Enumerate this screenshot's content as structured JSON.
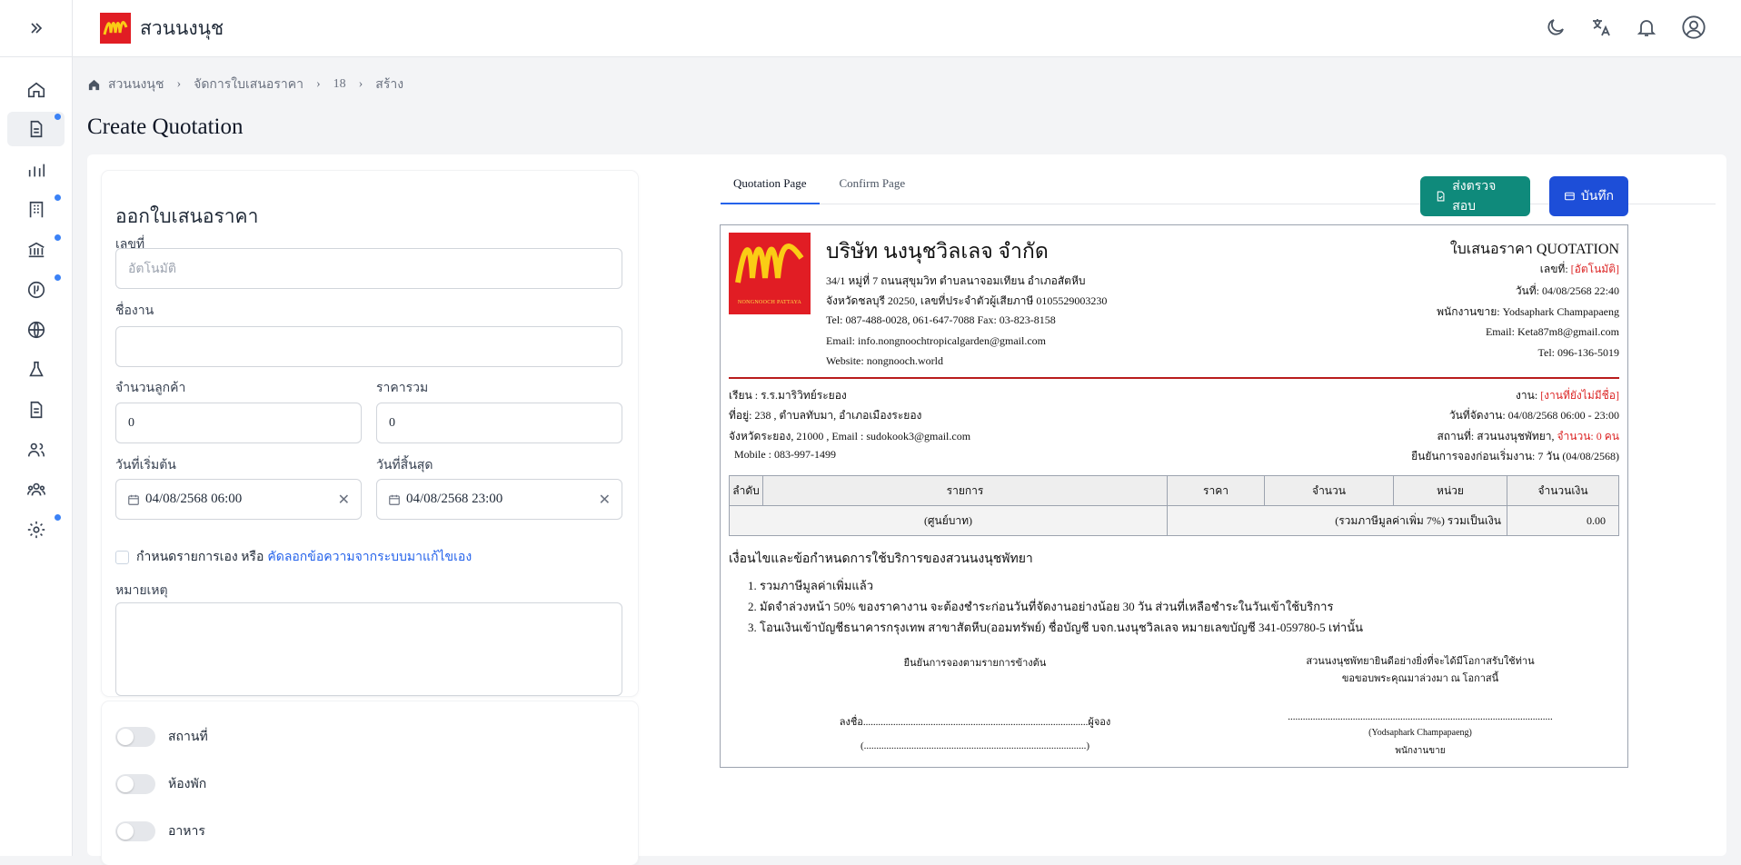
{
  "header": {
    "brand": "สวนนงนุช"
  },
  "breadcrumb": {
    "home": "สวนนงนุช",
    "section": "จัดการใบเสนอราคา",
    "id": "18",
    "action": "สร้าง"
  },
  "page": {
    "title": "Create Quotation"
  },
  "form": {
    "title": "ออกใบเสนอราคา",
    "number_label": "เลขที่",
    "number_placeholder": "อัตโนมัติ",
    "job_label": "ชื่องาน",
    "job_value": "",
    "customers_label": "จำนวนลูกค้า",
    "customers_value": "0",
    "total_label": "ราคารวม",
    "total_value": "0",
    "start_label": "วันที่เริ่มต้น",
    "start_value": "04/08/2568 06:00",
    "end_label": "วันที่สิ้นสุด",
    "end_value": "04/08/2568 23:00",
    "custom_text": "กำหนดรายการเอง หรือ",
    "custom_link": "คัดลอกข้อความจากระบบมาแก้ไขเอง",
    "note_label": "หมายเหตุ"
  },
  "toggles": [
    {
      "label": "สถานที่"
    },
    {
      "label": "ห้องพัก"
    },
    {
      "label": "อาหาร"
    }
  ],
  "tabs": [
    {
      "label": "Quotation Page"
    },
    {
      "label": "Confirm Page"
    }
  ],
  "buttons": {
    "review": "ส่งตรวจสอบ",
    "save": "บันทึก"
  },
  "doc": {
    "logo_text": "NONGNOOCH PATTAYA",
    "company": "บริษัท นงนุชวิลเลจ จำกัด",
    "address1": "34/1 หมู่ที่ 7 ถนนสุขุมวิท ตำบลนาจอมเทียน อำเภอสัตหีบ",
    "address2": "จังหวัดชลบุรี 20250, เลขที่ประจำตัวผู้เสียภาษี 0105529003230",
    "tel": "Tel: 087-488-0028, 061-647-7088 Fax: 03-823-8158",
    "email": "Email: info.nongnoochtropicalgarden@gmail.com",
    "website": "Website: nongnooch.world",
    "doc_title": "ใบเสนอราคา QUOTATION",
    "no_label": "เลขที่: ",
    "no_value": "[อัตโนมัติ]",
    "date": "วันที่: 04/08/2568 22:40",
    "sales": "พนักงานขาย: Yodsaphark Champapaeng",
    "sales_email": "Email: Keta87m8@gmail.com",
    "sales_tel": "Tel: 096-136-5019",
    "to": "เรียน : ร.ร.มาริวิทย์ระยอง",
    "to_addr1": "ที่อยู่: 238 , ตำบลทับมา, อำเภอเมืองระยอง",
    "to_addr2": "จังหวัดระยอง, 21000 , Email : sudokook3@gmail.com",
    "to_mobile": "Mobile : 083-997-1499",
    "job_label": "งาน: ",
    "job_value": "[งานที่ยังไม่มีชื่อ]",
    "event_date": "วันที่จัดงาน: 04/08/2568 06:00 - 23:00",
    "venue_label": "สถานที่: สวนนงนุชพัทยา, ",
    "venue_count": "จำนวน: 0 คน",
    "confirm_before": "ยืนยันการจองก่อนเริ่มงาน: 7 วัน (04/08/2568)",
    "table": {
      "headers": [
        "ลำดับ",
        "รายการ",
        "ราคา",
        "จำนวน",
        "หน่วย",
        "จำนวนเงิน"
      ],
      "words": "(ศูนย์บาท)",
      "total_label": "(รวมภาษีมูลค่าเพิ่ม 7%) รวมเป็นเงิน",
      "total_value": "0.00"
    },
    "conditions_title": "เงื่อนไขและข้อกำหนดการใช้บริการของสวนนงนุชพัทยา",
    "conditions": [
      "1. รวมภาษีมูลค่าเพิ่มแล้ว",
      "2. มัดจำล่วงหน้า 50% ของราคางาน จะต้องชำระก่อนวันที่จัดงานอย่างน้อย 30 วัน ส่วนที่เหลือชำระในวันเข้าใช้บริการ",
      "3. โอนเงินเข้าบัญชีธนาคารกรุงเทพ สาขาสัตหีบ(ออมทรัพย์) ชื่อบัญชี บจก.นงนุชวิลเลจ หมายเลขบัญชี 341-059780-5 เท่านั้น"
    ],
    "sig_left_title": "ยืนยันการจองตามรายการข้างต้น",
    "sig_left_line": "ลงชื่อ..........................................................................................ผู้จอง",
    "sig_left_paren": "(.........................................................................................)",
    "sig_right_title1": "สวนนงนุชพัทยายินดีอย่างยิ่งที่จะได้มีโอกาสรับใช้ท่าน",
    "sig_right_title2": "ขอขอบพระคุณมาล่วงมา ณ โอกาสนี้",
    "sig_right_line": "..........................................................................................................",
    "sig_right_name": "(Yodsaphark Champapaeng)",
    "sig_right_role": "พนักงานขาย"
  }
}
